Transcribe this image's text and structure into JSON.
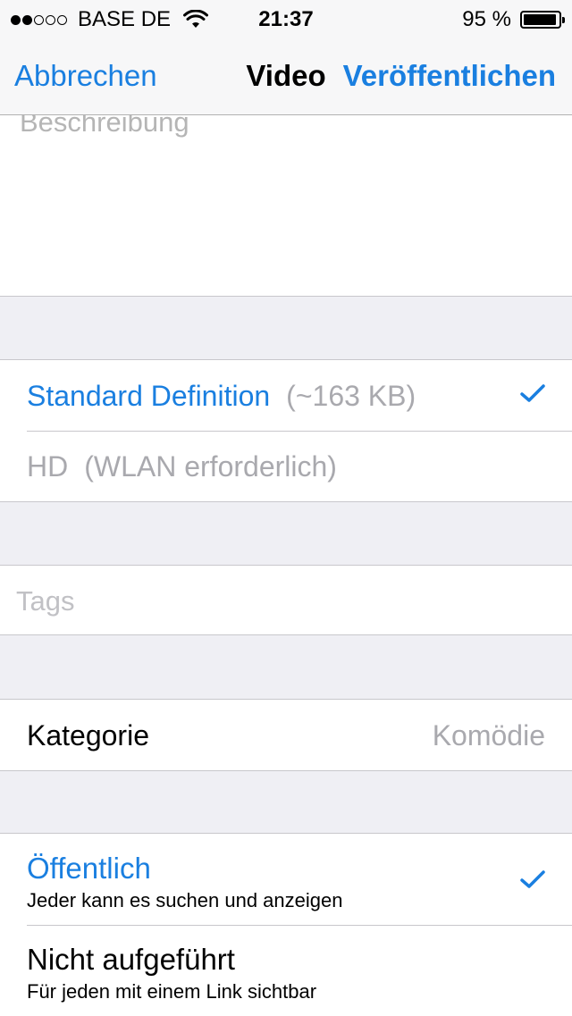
{
  "status_bar": {
    "carrier": "BASE DE",
    "time": "21:37",
    "battery": "95 %",
    "signal_bars_filled": 2,
    "signal_bars_total": 5
  },
  "nav": {
    "cancel": "Abbrechen",
    "title": "Video",
    "publish": "Veröffentlichen"
  },
  "description": {
    "placeholder": "Beschreibung"
  },
  "quality": {
    "options": [
      {
        "label": "Standard Definition",
        "note": "(~163 KB)",
        "selected": true
      },
      {
        "label": "HD",
        "note": "(WLAN erforderlich)",
        "selected": false
      }
    ]
  },
  "tags": {
    "placeholder": "Tags"
  },
  "category": {
    "label": "Kategorie",
    "value": "Komödie"
  },
  "privacy": {
    "options": [
      {
        "title": "Öffentlich",
        "subtitle": "Jeder kann es suchen und anzeigen",
        "selected": true
      },
      {
        "title": "Nicht aufgeführt",
        "subtitle": "Für jeden mit einem Link sichtbar",
        "selected": false
      }
    ]
  },
  "colors": {
    "accent": "#1a7fe0",
    "group_background": "#efeff4",
    "separator": "#c8c7cc",
    "placeholder": "#b5b5b5"
  }
}
